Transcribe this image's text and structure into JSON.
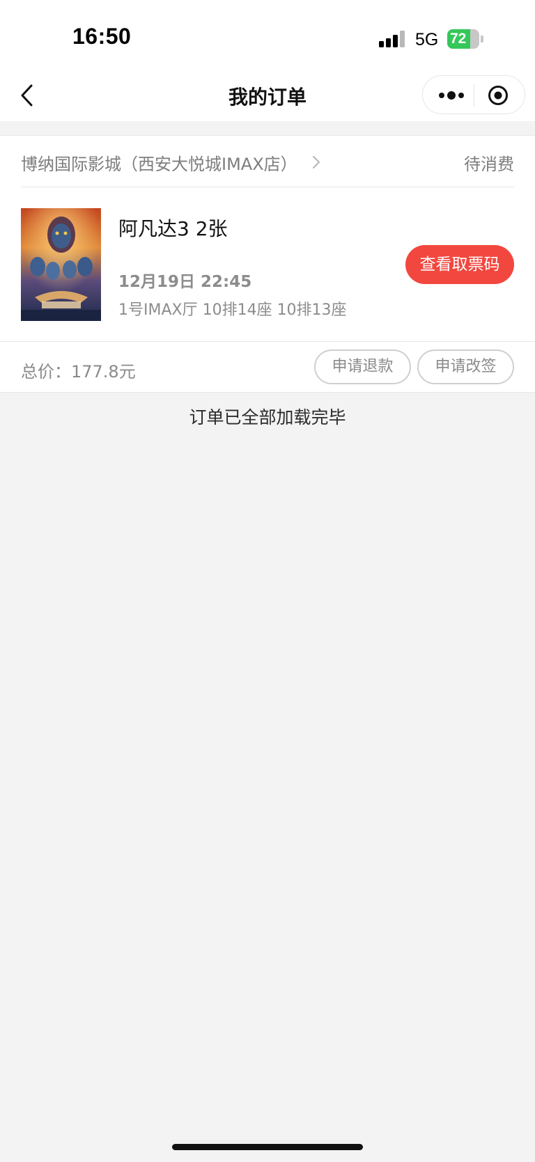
{
  "status_bar": {
    "time": "16:50",
    "network": "5G",
    "battery_level": 72,
    "battery_text": "72"
  },
  "nav": {
    "title": "我的订单",
    "back_icon": "chevron-left-icon",
    "more_icon": "more-dots-icon",
    "close_icon": "target-circle-icon"
  },
  "order": {
    "cinema": "博纳国际影城（西安大悦城IMAX店）",
    "status": "待消费",
    "movie_title": "阿凡达3 2张",
    "showtime": "12月19日 22:45",
    "seats": "1号IMAX厅 10排14座 10排13座",
    "view_ticket_code_label": "查看取票码",
    "total_price": "总价：177.8元",
    "refund_label": "申请退款",
    "reschedule_label": "申请改签"
  },
  "footer_text": "订单已全部加载完毕",
  "colors": {
    "accent": "#f2473f",
    "battery_green": "#34c759",
    "page_bg": "#f3f3f3"
  }
}
